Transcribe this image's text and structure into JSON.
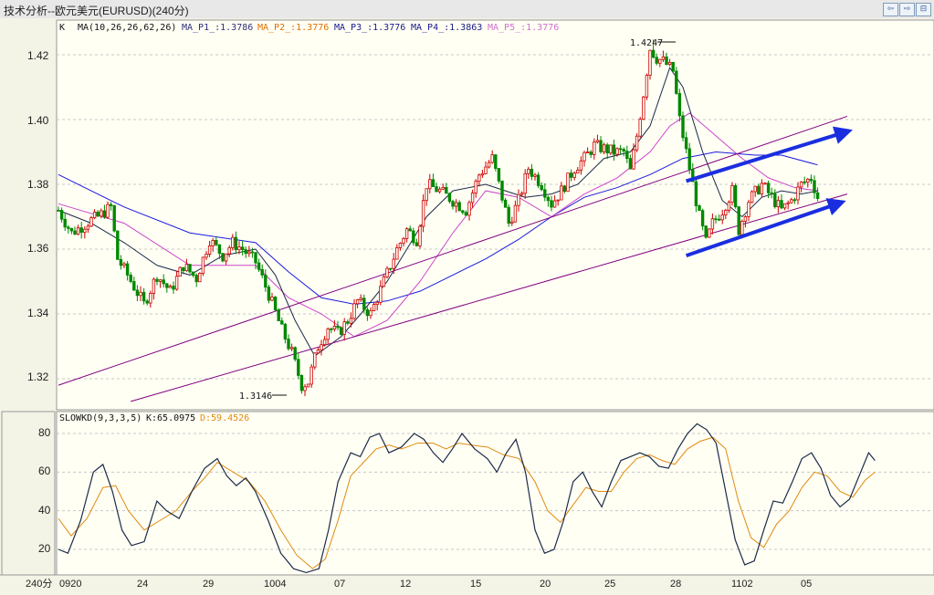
{
  "window": {
    "title": "技术分析--欧元美元(EURUSD)(240分)",
    "buttons": [
      "⇦",
      "⇨",
      "⊟"
    ]
  },
  "price_panel": {
    "header": {
      "k": "K",
      "ma": "MA(10,26,26,62,26)",
      "p1": "MA_P1_:1.3786",
      "p2": "MA_P2_:1.3776",
      "p3": "MA_P3_:1.3776",
      "p4": "MA_P4_:1.3863",
      "p5": "MA_P5_:1.3776"
    },
    "colors": {
      "p1": "#2f2f7a",
      "p2": "#e07000",
      "p3": "#1a1a8c",
      "p4": "#1a1a8c",
      "p5": "#d070d0",
      "candle_up": "#cc0000",
      "candle_down": "#008800",
      "trendline": "#800080",
      "arrow": "#1a2ee0",
      "ma_short": "#1c2a48",
      "ma_long": "#1a1ae0",
      "ma_mid": "#cc44cc"
    },
    "high_label": "1.4247",
    "low_label": "1.3146",
    "y_ticks": [
      "1.42",
      "1.40",
      "1.38",
      "1.36",
      "1.34",
      "1.32"
    ]
  },
  "kd_panel": {
    "header": {
      "name": "SLOWKD(9,3,3,5)",
      "k": "K:65.0975",
      "d": "D:59.4526"
    },
    "y_ticks": [
      "80",
      "60",
      "40",
      "20"
    ],
    "colors": {
      "k": "#1c2a48",
      "d": "#e08a10"
    }
  },
  "x_axis": {
    "period": "240分",
    "labels": [
      "0920",
      "24",
      "29",
      "1004",
      "07",
      "12",
      "15",
      "20",
      "25",
      "28",
      "1102",
      "05"
    ]
  },
  "chart_data": [
    {
      "type": "candlestick",
      "title": "EURUSD 240分",
      "ylim": [
        1.312,
        1.428
      ],
      "high": 1.4247,
      "low": 1.3146,
      "ma_values": {
        "MA_P1_": 1.3786,
        "MA_P2_": 1.3776,
        "MA_P3_": 1.3776,
        "MA_P4_": 1.3863,
        "MA_P5_": 1.3776
      },
      "close_path": [
        [
          0,
          1.372
        ],
        [
          4,
          1.365
        ],
        [
          10,
          1.369
        ],
        [
          12,
          1.37
        ],
        [
          16,
          1.373
        ],
        [
          18,
          1.357
        ],
        [
          21,
          1.352
        ],
        [
          26,
          1.343
        ],
        [
          30,
          1.352
        ],
        [
          34,
          1.347
        ],
        [
          38,
          1.355
        ],
        [
          42,
          1.351
        ],
        [
          46,
          1.363
        ],
        [
          50,
          1.358
        ],
        [
          53,
          1.362
        ],
        [
          56,
          1.36
        ],
        [
          60,
          1.356
        ],
        [
          64,
          1.346
        ],
        [
          68,
          1.335
        ],
        [
          71,
          1.328
        ],
        [
          74,
          1.318
        ],
        [
          76,
          1.319
        ],
        [
          79,
          1.33
        ],
        [
          82,
          1.336
        ],
        [
          85,
          1.334
        ],
        [
          88,
          1.338
        ],
        [
          91,
          1.344
        ],
        [
          95,
          1.34
        ],
        [
          99,
          1.35
        ],
        [
          103,
          1.36
        ],
        [
          106,
          1.366
        ],
        [
          109,
          1.363
        ],
        [
          112,
          1.38
        ],
        [
          116,
          1.378
        ],
        [
          120,
          1.375
        ],
        [
          124,
          1.372
        ],
        [
          128,
          1.383
        ],
        [
          132,
          1.388
        ],
        [
          134,
          1.38
        ],
        [
          137,
          1.368
        ],
        [
          140,
          1.375
        ],
        [
          143,
          1.385
        ],
        [
          147,
          1.38
        ],
        [
          150,
          1.374
        ],
        [
          153,
          1.378
        ],
        [
          157,
          1.385
        ],
        [
          160,
          1.388
        ],
        [
          163,
          1.392
        ],
        [
          166,
          1.391
        ],
        [
          169,
          1.39
        ],
        [
          172,
          1.39
        ],
        [
          174,
          1.384
        ],
        [
          176,
          1.395
        ],
        [
          178,
          1.408
        ],
        [
          180,
          1.422
        ],
        [
          182,
          1.419
        ],
        [
          184,
          1.418
        ],
        [
          187,
          1.415
        ],
        [
          189,
          1.4
        ],
        [
          191,
          1.39
        ],
        [
          193,
          1.38
        ],
        [
          195,
          1.37
        ],
        [
          197,
          1.362
        ],
        [
          199,
          1.368
        ],
        [
          202,
          1.372
        ],
        [
          205,
          1.378
        ],
        [
          207,
          1.366
        ],
        [
          210,
          1.375
        ],
        [
          214,
          1.38
        ],
        [
          217,
          1.376
        ],
        [
          220,
          1.372
        ],
        [
          223,
          1.375
        ],
        [
          226,
          1.38
        ],
        [
          229,
          1.382
        ],
        [
          231,
          1.376
        ]
      ],
      "ma_short_path": [
        [
          0,
          1.372
        ],
        [
          10,
          1.368
        ],
        [
          20,
          1.362
        ],
        [
          30,
          1.355
        ],
        [
          40,
          1.352
        ],
        [
          50,
          1.358
        ],
        [
          60,
          1.36
        ],
        [
          66,
          1.352
        ],
        [
          72,
          1.338
        ],
        [
          78,
          1.327
        ],
        [
          86,
          1.333
        ],
        [
          92,
          1.34
        ],
        [
          100,
          1.35
        ],
        [
          106,
          1.36
        ],
        [
          112,
          1.37
        ],
        [
          120,
          1.378
        ],
        [
          130,
          1.38
        ],
        [
          136,
          1.378
        ],
        [
          142,
          1.376
        ],
        [
          150,
          1.377
        ],
        [
          158,
          1.38
        ],
        [
          166,
          1.388
        ],
        [
          174,
          1.39
        ],
        [
          180,
          1.398
        ],
        [
          186,
          1.416
        ],
        [
          190,
          1.41
        ],
        [
          196,
          1.39
        ],
        [
          202,
          1.375
        ],
        [
          208,
          1.37
        ],
        [
          214,
          1.376
        ],
        [
          220,
          1.378
        ],
        [
          226,
          1.377
        ],
        [
          231,
          1.378
        ]
      ],
      "ma_mid_path": [
        [
          0,
          1.374
        ],
        [
          20,
          1.368
        ],
        [
          40,
          1.355
        ],
        [
          60,
          1.355
        ],
        [
          70,
          1.345
        ],
        [
          80,
          1.34
        ],
        [
          90,
          1.333
        ],
        [
          100,
          1.338
        ],
        [
          110,
          1.35
        ],
        [
          120,
          1.365
        ],
        [
          130,
          1.378
        ],
        [
          140,
          1.376
        ],
        [
          150,
          1.37
        ],
        [
          160,
          1.377
        ],
        [
          170,
          1.382
        ],
        [
          180,
          1.39
        ],
        [
          186,
          1.398
        ],
        [
          192,
          1.402
        ],
        [
          200,
          1.395
        ],
        [
          208,
          1.388
        ],
        [
          216,
          1.382
        ],
        [
          224,
          1.379
        ],
        [
          231,
          1.378
        ]
      ],
      "ma_long_path": [
        [
          0,
          1.383
        ],
        [
          20,
          1.373
        ],
        [
          40,
          1.365
        ],
        [
          60,
          1.362
        ],
        [
          70,
          1.353
        ],
        [
          80,
          1.345
        ],
        [
          90,
          1.343
        ],
        [
          100,
          1.344
        ],
        [
          110,
          1.347
        ],
        [
          120,
          1.352
        ],
        [
          130,
          1.357
        ],
        [
          140,
          1.363
        ],
        [
          150,
          1.37
        ],
        [
          160,
          1.376
        ],
        [
          170,
          1.379
        ],
        [
          180,
          1.383
        ],
        [
          190,
          1.388
        ],
        [
          200,
          1.39
        ],
        [
          212,
          1.389
        ],
        [
          220,
          1.389
        ],
        [
          231,
          1.386
        ]
      ],
      "channel_lines": [
        [
          [
            0,
            1.318
          ],
          [
            240,
            1.401
          ]
        ],
        [
          [
            22,
            1.313
          ],
          [
            240,
            1.377
          ]
        ]
      ],
      "channel_arrows": [
        [
          [
            191,
            1.381
          ],
          [
            239,
            1.396
          ]
        ],
        [
          [
            191,
            1.358
          ],
          [
            237,
            1.374
          ]
        ]
      ]
    },
    {
      "type": "line",
      "title": "SLOWKD(9,3,3,5)",
      "ylim": [
        5,
        88
      ],
      "series": [
        {
          "name": "K",
          "values": [
            [
              0,
              20
            ],
            [
              3,
              18
            ],
            [
              7,
              35
            ],
            [
              11,
              60
            ],
            [
              14,
              64
            ],
            [
              17,
              50
            ],
            [
              20,
              30
            ],
            [
              23,
              22
            ],
            [
              27,
              24
            ],
            [
              31,
              45
            ],
            [
              34,
              40
            ],
            [
              38,
              36
            ],
            [
              42,
              50
            ],
            [
              46,
              62
            ],
            [
              50,
              67
            ],
            [
              53,
              58
            ],
            [
              56,
              53
            ],
            [
              59,
              57
            ],
            [
              62,
              50
            ],
            [
              66,
              35
            ],
            [
              70,
              18
            ],
            [
              74,
              10
            ],
            [
              78,
              8
            ],
            [
              82,
              10
            ],
            [
              85,
              30
            ],
            [
              88,
              55
            ],
            [
              92,
              70
            ],
            [
              95,
              68
            ],
            [
              98,
              78
            ],
            [
              101,
              80
            ],
            [
              104,
              70
            ],
            [
              108,
              73
            ],
            [
              112,
              80
            ],
            [
              115,
              77
            ],
            [
              118,
              70
            ],
            [
              121,
              65
            ],
            [
              124,
              72
            ],
            [
              127,
              80
            ],
            [
              131,
              72
            ],
            [
              135,
              67
            ],
            [
              138,
              60
            ],
            [
              141,
              70
            ],
            [
              144,
              77
            ],
            [
              147,
              60
            ],
            [
              150,
              30
            ],
            [
              153,
              18
            ],
            [
              156,
              20
            ],
            [
              159,
              35
            ],
            [
              162,
              55
            ],
            [
              165,
              60
            ],
            [
              168,
              50
            ],
            [
              171,
              42
            ],
            [
              174,
              55
            ],
            [
              177,
              66
            ],
            [
              180,
              68
            ],
            [
              183,
              70
            ],
            [
              186,
              68
            ],
            [
              189,
              63
            ],
            [
              192,
              62
            ],
            [
              195,
              72
            ],
            [
              198,
              80
            ],
            [
              201,
              85
            ],
            [
              204,
              82
            ],
            [
              207,
              75
            ],
            [
              210,
              50
            ],
            [
              213,
              25
            ],
            [
              216,
              12
            ],
            [
              219,
              14
            ],
            [
              222,
              30
            ],
            [
              225,
              45
            ],
            [
              228,
              44
            ],
            [
              231,
              55
            ],
            [
              234,
              67
            ],
            [
              237,
              70
            ],
            [
              240,
              62
            ],
            [
              243,
              48
            ],
            [
              246,
              42
            ],
            [
              249,
              46
            ],
            [
              252,
              58
            ],
            [
              255,
              70
            ],
            [
              257,
              66
            ]
          ]
        },
        {
          "name": "D",
          "values": [
            [
              0,
              36
            ],
            [
              4,
              27
            ],
            [
              9,
              36
            ],
            [
              14,
              52
            ],
            [
              18,
              53
            ],
            [
              22,
              40
            ],
            [
              27,
              30
            ],
            [
              32,
              35
            ],
            [
              37,
              40
            ],
            [
              42,
              50
            ],
            [
              46,
              57
            ],
            [
              50,
              65
            ],
            [
              55,
              60
            ],
            [
              60,
              55
            ],
            [
              65,
              45
            ],
            [
              70,
              30
            ],
            [
              75,
              17
            ],
            [
              80,
              10
            ],
            [
              84,
              15
            ],
            [
              88,
              35
            ],
            [
              92,
              58
            ],
            [
              96,
              65
            ],
            [
              100,
              72
            ],
            [
              104,
              74
            ],
            [
              108,
              72
            ],
            [
              113,
              75
            ],
            [
              118,
              75
            ],
            [
              122,
              72
            ],
            [
              126,
              75
            ],
            [
              130,
              74
            ],
            [
              135,
              73
            ],
            [
              140,
              69
            ],
            [
              145,
              67
            ],
            [
              150,
              55
            ],
            [
              154,
              40
            ],
            [
              158,
              34
            ],
            [
              162,
              43
            ],
            [
              166,
              52
            ],
            [
              170,
              50
            ],
            [
              174,
              50
            ],
            [
              178,
              60
            ],
            [
              182,
              67
            ],
            [
              186,
              69
            ],
            [
              190,
              66
            ],
            [
              194,
              64
            ],
            [
              198,
              72
            ],
            [
              202,
              76
            ],
            [
              206,
              78
            ],
            [
              210,
              72
            ],
            [
              214,
              45
            ],
            [
              218,
              26
            ],
            [
              222,
              21
            ],
            [
              226,
              33
            ],
            [
              230,
              40
            ],
            [
              234,
              52
            ],
            [
              238,
              60
            ],
            [
              242,
              58
            ],
            [
              246,
              50
            ],
            [
              250,
              47
            ],
            [
              254,
              56
            ],
            [
              257,
              60
            ]
          ]
        }
      ]
    }
  ]
}
